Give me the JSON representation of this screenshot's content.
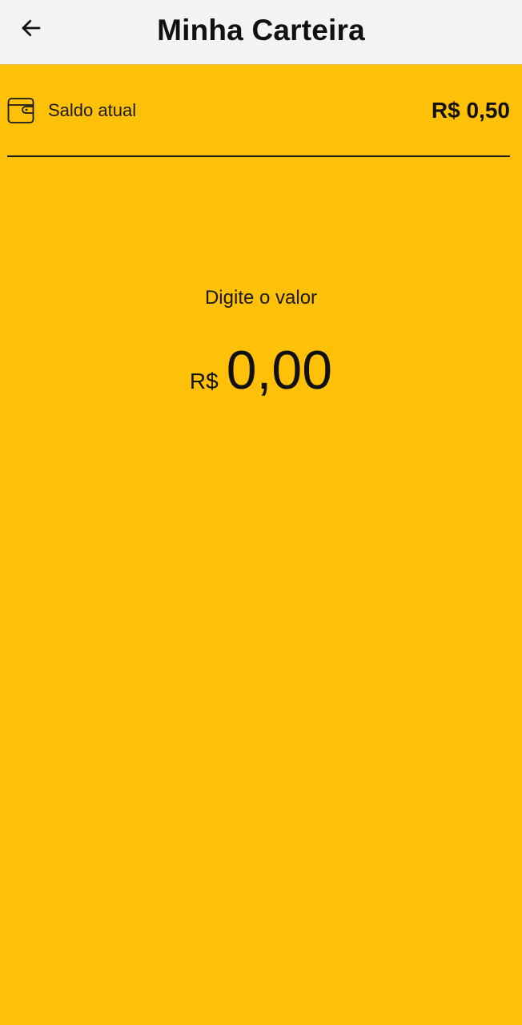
{
  "header": {
    "title": "Minha Carteira",
    "back_icon": "arrow-left-icon"
  },
  "balance": {
    "icon": "wallet-icon",
    "label": "Saldo atual",
    "value": "R$ 0,50"
  },
  "entry": {
    "prompt": "Digite o valor",
    "currency": "R$",
    "amount": "0,00"
  },
  "colors": {
    "background": "#FFC107",
    "app_bar": "#F4F4F4",
    "text": "#111111"
  }
}
